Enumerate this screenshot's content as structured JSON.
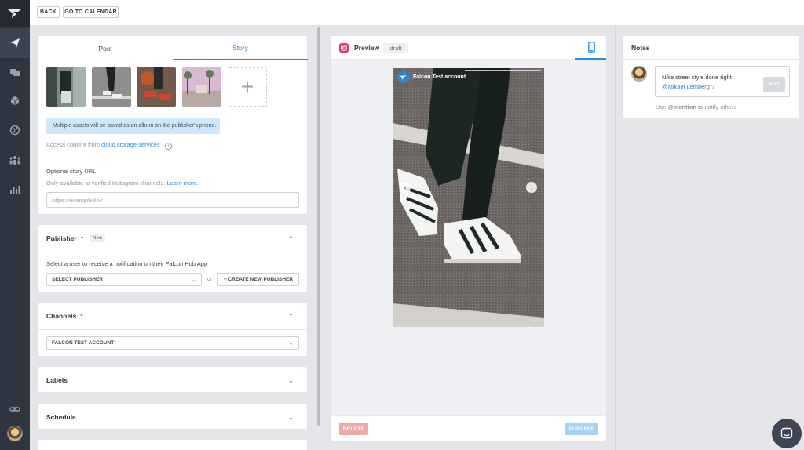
{
  "topbar": {
    "back_label": "BACK",
    "calendar_label": "GO TO CALENDAR"
  },
  "sidebar": {
    "items": [
      {
        "icon": "paper-plane-icon"
      },
      {
        "icon": "chat-bubbles-icon"
      },
      {
        "icon": "cubes-icon"
      },
      {
        "icon": "globe-icon"
      },
      {
        "icon": "users-icon"
      },
      {
        "icon": "bar-chart-icon"
      },
      {
        "icon": "link-icon"
      }
    ]
  },
  "composer": {
    "tabs": [
      {
        "label": "Post"
      },
      {
        "label": "Story"
      }
    ],
    "add_symbol": "+",
    "album_notice": "Multiple assets will be saved as an album on the publisher's phone.",
    "access_prefix": "Access content from",
    "access_link": "cloud storage services",
    "story_url_label": "Optional story URL",
    "story_url_help": "Only available to verified Instagram channels.",
    "learn_more": "Learn more.",
    "story_url_placeholder": "https://example.link"
  },
  "publisher": {
    "title": "Publisher",
    "required_mark": "*",
    "badge": "New",
    "description": "Select a user to receive a notification on their Falcon Hub App",
    "select_label": "SELECT PUBLISHER",
    "or_label": "or",
    "create_label": "+ CREATE NEW PUBLISHER"
  },
  "channels": {
    "title": "Channels",
    "required_mark": "*",
    "selected": "FALCON TEST ACCOUNT"
  },
  "labels_section": {
    "title": "Labels"
  },
  "schedule_section": {
    "title": "Schedule"
  },
  "preview": {
    "title": "Preview",
    "status": "draft",
    "account_name": "Falcon Test account",
    "more_symbol": "•••",
    "delete_label": "DELETE",
    "publish_label": "PUBLISH"
  },
  "notes": {
    "title": "Notes",
    "note_text": "Nike street style done right",
    "mention": "@Mikael Lemberg",
    "note_suffix": "?",
    "add_label": "ADD",
    "hint_prefix": "Use",
    "hint_mention": "@mention",
    "hint_suffix": "to notify others"
  },
  "colors": {
    "accent": "#2a8ad9",
    "sidebar": "#2e3440",
    "danger": "#e04646",
    "instagram": "#e1306c"
  }
}
